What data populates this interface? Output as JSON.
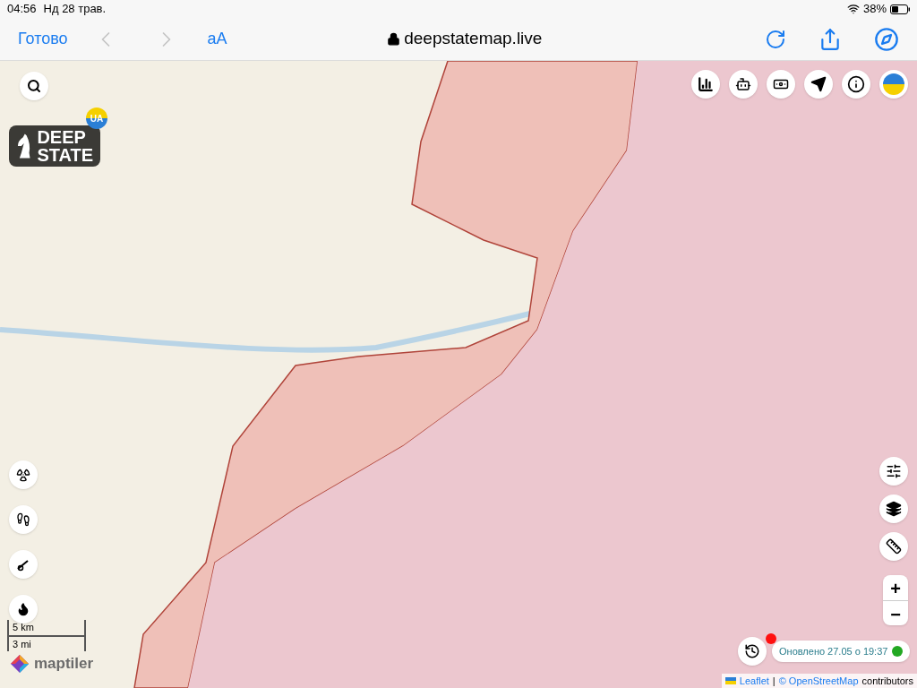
{
  "status_bar": {
    "time": "04:56",
    "date": "Нд 28 трав.",
    "battery": "38%"
  },
  "browser": {
    "done": "Готово",
    "text_size": "aA",
    "address": "deepstatemap.live"
  },
  "map": {
    "logo": {
      "line_1": "DEEP",
      "line_2": "STATE"
    },
    "badge": "UA",
    "scale": {
      "metric": "5 km",
      "imperial": "3 mi"
    },
    "tiles_logo": "maptiler",
    "zoom": {
      "in": "+",
      "out": "−"
    },
    "update": "Оновлено 27.05 о 19:37",
    "attribution": {
      "leaflet": "Leaflet",
      "separator": "|",
      "osm": "© OpenStreetMap",
      "rest": "contributors"
    }
  }
}
